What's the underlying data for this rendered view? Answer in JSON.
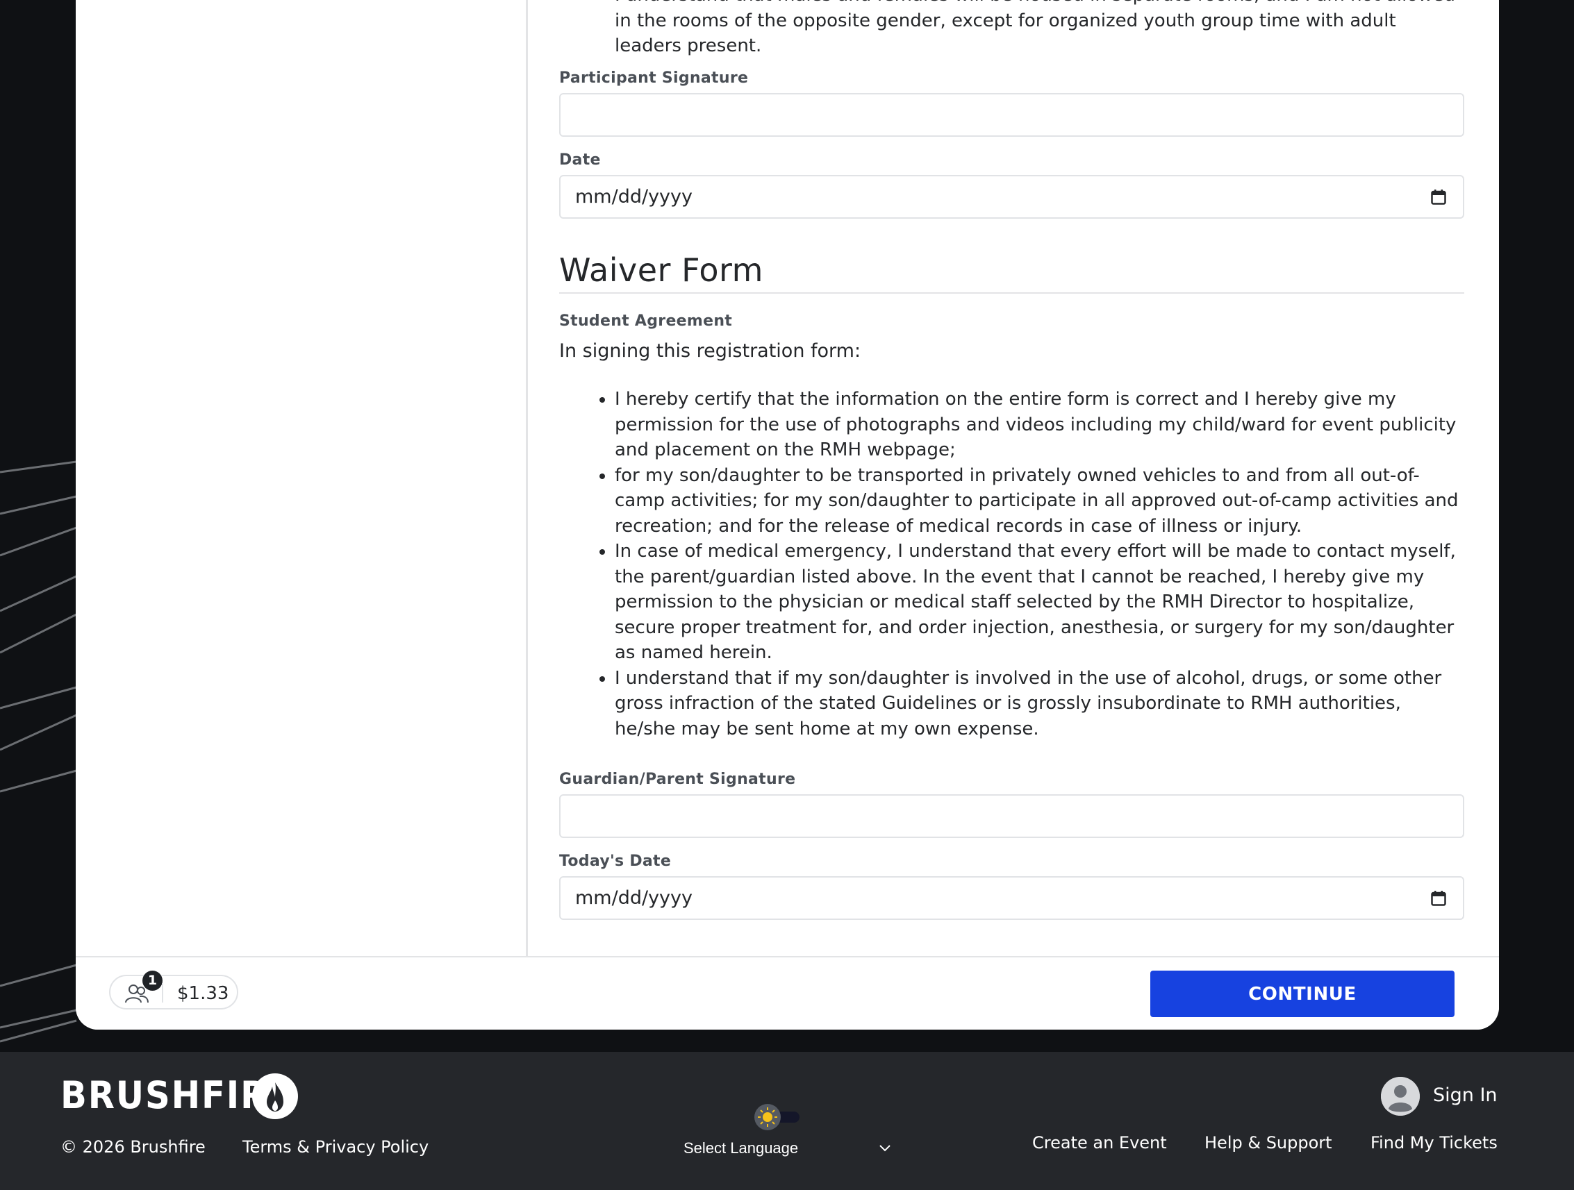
{
  "form": {
    "prev_list_tail": [
      "I understand that males and females will be housed in separate rooms, and I am not allowed in the rooms of the opposite gender, except for organized youth group time with adult leaders present."
    ],
    "participant_signature_label": "Participant Signature",
    "participant_signature_value": "",
    "date_label": "Date",
    "date_placeholder": "mm/dd/yyyy",
    "waiver_title": "Waiver Form",
    "student_agreement_label": "Student Agreement",
    "intro": "In signing this registration form:",
    "agreement_items": [
      "I hereby certify that the information on the entire form is correct and I hereby give my permission for the use of photographs and videos including my child/ward for event publicity and placement on the RMH webpage;",
      "for my son/daughter to be transported in privately owned vehicles to and from all out-of-camp activities; for my son/daughter to participate in all approved out-of-camp activities and recreation; and for the release of medical records in case of illness or injury.",
      "In case of medical emergency, I understand that every effort will be made to contact myself, the parent/guardian listed above.  In the event that I cannot be reached, I hereby give my permission to the physician or medical staff selected by the RMH Director to hospitalize, secure proper treatment for, and order injection, anesthesia, or surgery for my son/daughter as named herein.",
      "I understand that if my son/daughter is involved in the use of alcohol, drugs, or some other gross infraction of the stated Guidelines or is grossly insubordinate to RMH authorities, he/she may be sent home at my own expense."
    ],
    "guardian_signature_label": "Guardian/Parent Signature",
    "guardian_signature_value": "",
    "todays_date_label": "Today's Date",
    "todays_date_placeholder": "mm/dd/yyyy"
  },
  "cart": {
    "attendee_count": "1",
    "total": "$1.33",
    "people_icon": "people-icon"
  },
  "continue_label": "CONTINUE",
  "footer": {
    "brand": "BRUSHFIRE",
    "copyright": "© 2026 Brushfire",
    "terms": "Terms & Privacy Policy",
    "language": "Select Language",
    "sign_in": "Sign In",
    "links": [
      "Create an Event",
      "Help & Support",
      "Find My Tickets"
    ]
  },
  "colors": {
    "accent": "#1742e0",
    "footer_bg": "#25272b",
    "page_bg": "#0f1114"
  }
}
